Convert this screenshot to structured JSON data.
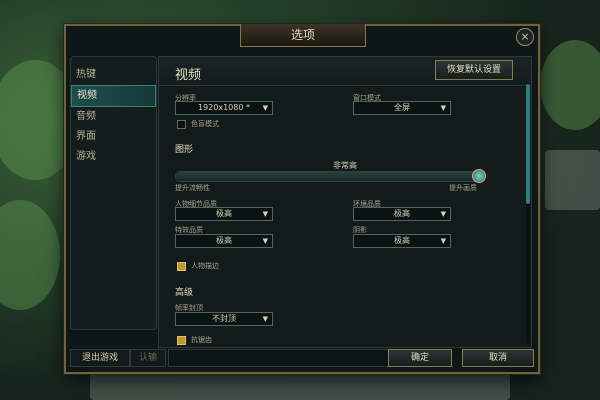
{
  "dialog": {
    "title": "选项",
    "close_icon": "×"
  },
  "sidebar": {
    "items": [
      {
        "label": "热键"
      },
      {
        "label": "视频",
        "active": true
      },
      {
        "label": "音频"
      },
      {
        "label": "界面"
      },
      {
        "label": "游戏"
      }
    ]
  },
  "content": {
    "section_title": "视频",
    "restore_defaults": "恢复默认设置",
    "resolution": {
      "label": "分辨率",
      "value": "1920x1080 *"
    },
    "window_mode": {
      "label": "窗口模式",
      "value": "全屏"
    },
    "colorblind": {
      "label": "色盲模式",
      "checked": false
    },
    "graphics": {
      "title": "图形",
      "quality_label": "非常高",
      "slider_level_fraction": 1.0,
      "left_hint": "提升流畅性",
      "right_hint": "提升画质"
    },
    "char_quality": {
      "label": "人物细节品质",
      "value": "极高"
    },
    "env_quality": {
      "label": "环境品质",
      "value": "极高"
    },
    "effects_quality": {
      "label": "特效品质",
      "value": "极高"
    },
    "shadows": {
      "label": "阴影",
      "value": "极高"
    },
    "char_outline": {
      "label": "人物描边",
      "checked": true
    },
    "advanced": {
      "title": "高级",
      "fps_cap": {
        "label": "帧率封顶",
        "value": "不封顶"
      },
      "anti_alias": {
        "label": "抗锯齿",
        "checked": true
      }
    }
  },
  "footer": {
    "exit_game": "退出游戏",
    "surrender": "认输",
    "confirm": "确定",
    "cancel": "取消"
  },
  "colors": {
    "accent_teal": "#2e7c80",
    "gold": "#8a7a50"
  }
}
